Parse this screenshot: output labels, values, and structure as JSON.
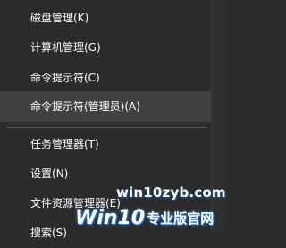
{
  "menu": {
    "items": [
      {
        "label": "磁盘管理(K)"
      },
      {
        "label": "计算机管理(G)"
      },
      {
        "label": "命令提示符(C)"
      },
      {
        "label": "命令提示符(管理员)(A)"
      },
      {
        "label": "任务管理器(T)"
      },
      {
        "label": "设置(N)"
      },
      {
        "label": "文件资源管理器(E)"
      },
      {
        "label": "搜索(S)"
      }
    ]
  },
  "watermark": {
    "site": "win10zyb.com",
    "brand": "Win10",
    "tagline": "专业版官网"
  },
  "colors": {
    "background": "#2b2b2b",
    "hover": "#414141",
    "separator": "#5a5a5a",
    "text": "#ffffff",
    "watermark_glow": "#2a7fd4"
  }
}
